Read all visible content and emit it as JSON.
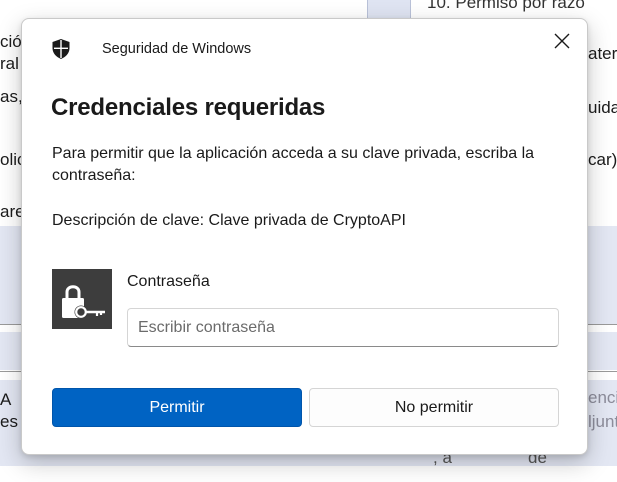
{
  "background_doc": {
    "left_fragments": [
      "ción",
      "ral",
      "as,",
      "olic",
      "are",
      "A",
      "es"
    ],
    "right_fragments": [
      "10. Permiso por razo",
      "ater",
      "uida",
      "car)",
      "encia",
      "ljunt"
    ],
    "bottom_fragment": ", a",
    "bottom_fragment_2": "de"
  },
  "dialog": {
    "app_title": "Seguridad de Windows",
    "shield_icon": "shield-icon",
    "close_icon": "close-icon",
    "heading": "Credenciales requeridas",
    "message": "Para permitir que la aplicación acceda a su clave privada, escriba la contraseña:",
    "key_description": "Descripción de clave: Clave privada de CryptoAPI",
    "credential_icon": "lock-key-icon",
    "password": {
      "label": "Contraseña",
      "placeholder": "Escribir contraseña",
      "value": ""
    },
    "buttons": {
      "allow": "Permitir",
      "deny": "No permitir"
    }
  },
  "colors": {
    "primary_button": "#0063c3",
    "credential_tile": "#3d3d3d",
    "background_band": "#e3e7f3"
  }
}
